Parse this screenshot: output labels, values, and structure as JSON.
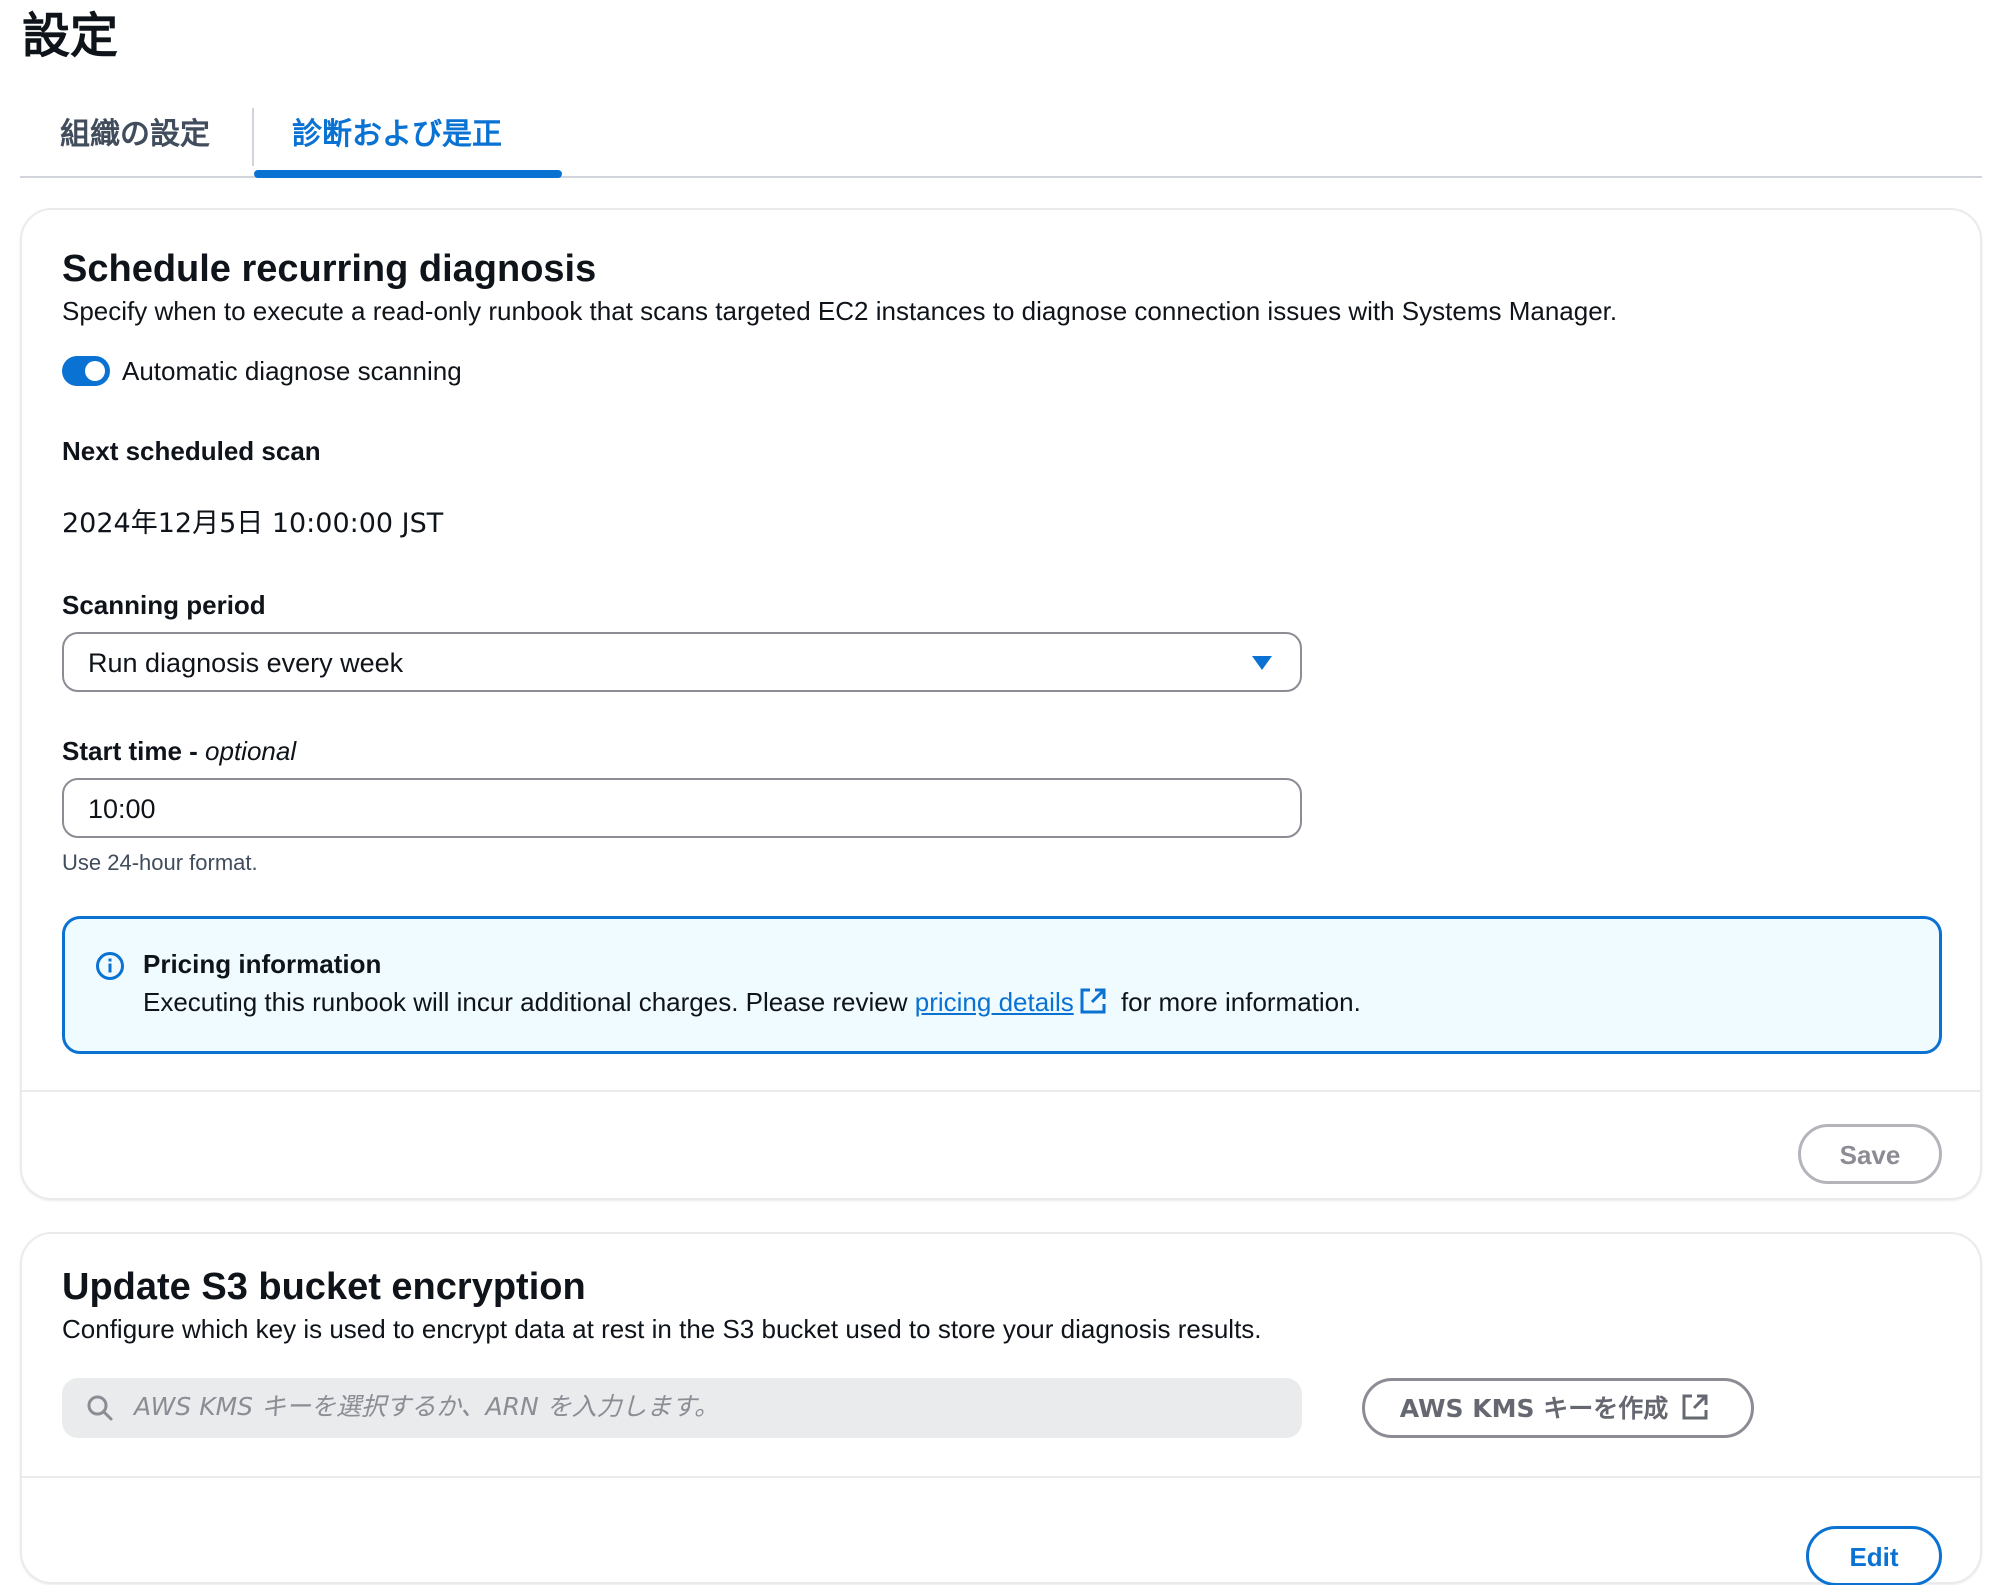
{
  "page": {
    "title": "設定"
  },
  "tabs": [
    {
      "label": "組織の設定",
      "active": false
    },
    {
      "label": "診断および是正",
      "active": true
    }
  ],
  "colors": {
    "accent": "#0972d3",
    "info_bg": "#f0fbff",
    "disabled": "#8c8c94"
  },
  "schedule": {
    "title": "Schedule recurring diagnosis",
    "description": "Specify when to execute a read-only runbook that scans targeted EC2 instances to diagnose connection issues with Systems Manager.",
    "toggle_label": "Automatic diagnose scanning",
    "toggle_on": true,
    "next_scan_label": "Next scheduled scan",
    "next_scan_value": "2024年12月5日 10:00:00 JST",
    "period_label": "Scanning period",
    "period_value": "Run diagnosis every week",
    "start_time_label": "Start time - ",
    "start_time_optional": "optional",
    "start_time_value": "10:00",
    "start_time_hint": "Use 24-hour format.",
    "pricing": {
      "title": "Pricing information",
      "body_before": "Executing this runbook will incur additional charges. Please review ",
      "link_text": "pricing details",
      "body_after": " for more information.",
      "icon": "info-icon"
    },
    "save_label": "Save"
  },
  "encryption": {
    "title": "Update S3 bucket encryption",
    "description": "Configure which key is used to encrypt data at rest in the S3 bucket used to store your diagnosis results.",
    "search_placeholder": "AWS KMS キーを選択するか、ARN を入力します。",
    "create_key_label": "AWS KMS キーを作成",
    "edit_label": "Edit"
  }
}
